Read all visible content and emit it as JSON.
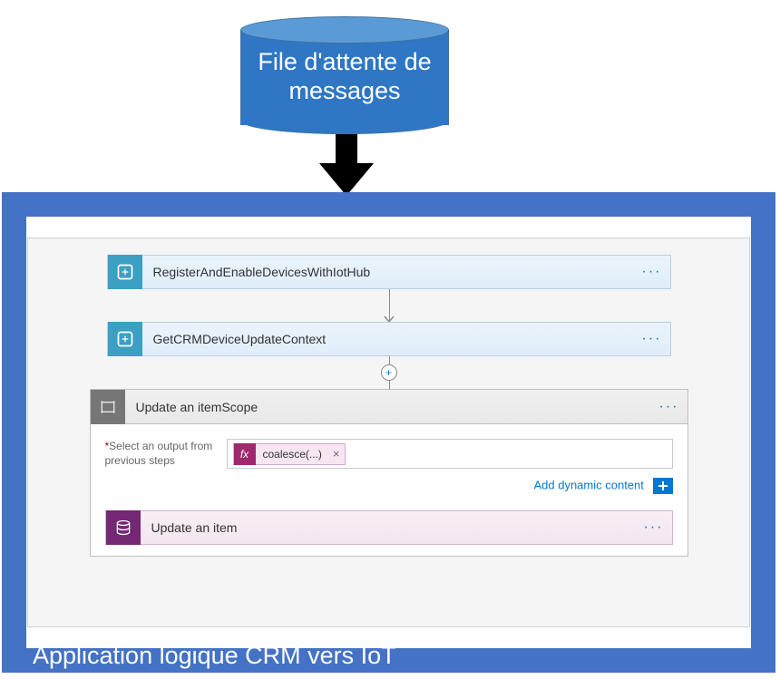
{
  "cylinder": {
    "label": "File d'attente de messages"
  },
  "frame": {
    "label": "Application logique CRM vers IoT"
  },
  "workflow": {
    "step1": {
      "title": "RegisterAndEnableDevicesWithIotHub"
    },
    "step2": {
      "title": "GetCRMDeviceUpdateContext"
    },
    "scope": {
      "title": "Update an itemScope",
      "field_label_prefix": "*",
      "field_label": "Select an output from previous steps",
      "token_label": "coalesce(...)",
      "dynamic_link": "Add dynamic content",
      "inner_action": {
        "title": "Update an item"
      }
    }
  }
}
